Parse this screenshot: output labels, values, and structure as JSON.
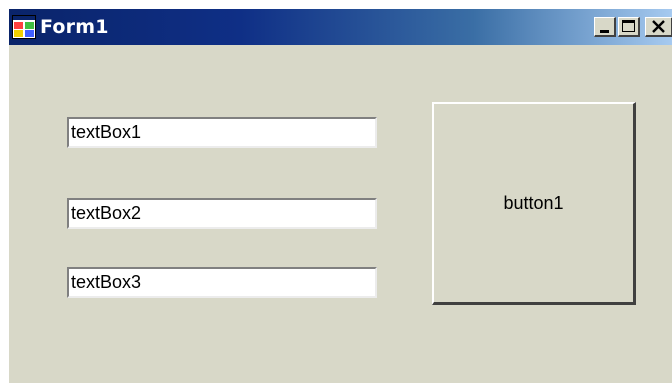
{
  "window": {
    "title": "Form1",
    "icon": "form-icon",
    "controls": {
      "minimize_icon": "minimize-icon",
      "maximize_icon": "maximize-icon",
      "close_icon": "close-icon"
    },
    "colors": {
      "titlebar_start": "#0a246a",
      "titlebar_end": "#a6caf0",
      "client_background": "#d8d8c8"
    }
  },
  "form": {
    "textboxes": [
      {
        "value": "textBox1"
      },
      {
        "value": "textBox2"
      },
      {
        "value": "textBox3"
      }
    ],
    "button": {
      "label": "button1"
    }
  }
}
